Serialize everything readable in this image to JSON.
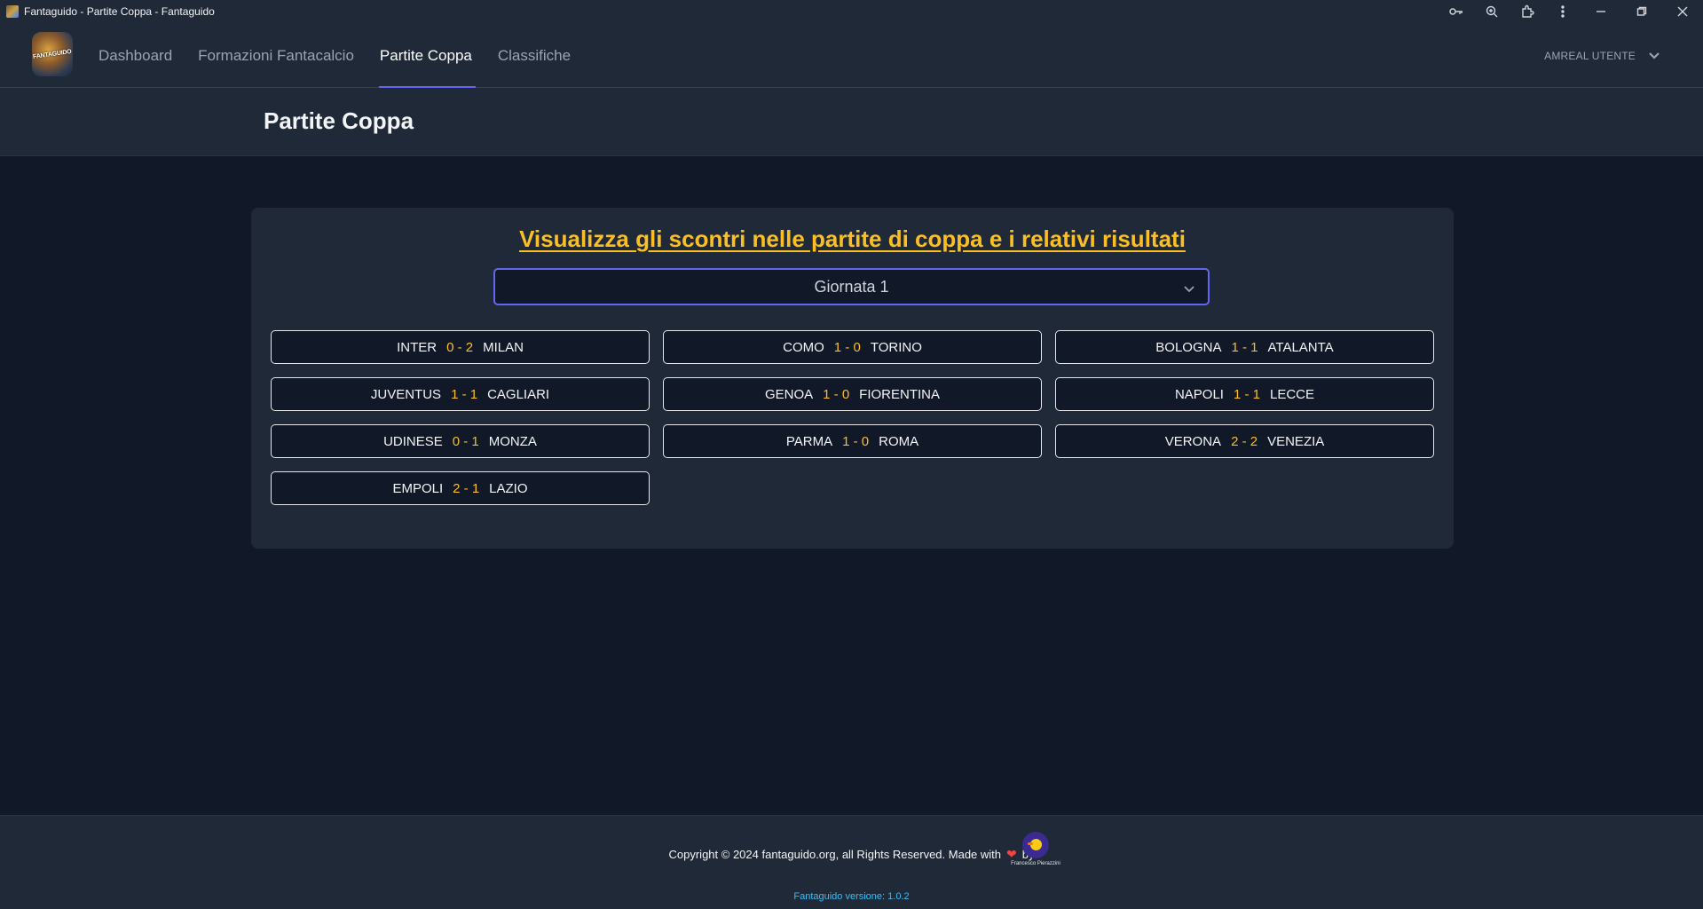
{
  "window": {
    "title": "Fantaguido - Partite Coppa - Fantaguido",
    "icons": [
      "key-icon",
      "zoom-icon",
      "extensions-icon",
      "more-icon",
      "minimize-icon",
      "restore-icon",
      "close-icon"
    ]
  },
  "nav": {
    "logo_text": "FANTAGUIDO",
    "links": [
      "Dashboard",
      "Formazioni Fantacalcio",
      "Partite Coppa",
      "Classifiche"
    ],
    "active": "Partite Coppa",
    "user_label": "AMREAL UTENTE"
  },
  "page": {
    "title": "Partite Coppa"
  },
  "card": {
    "heading": "Visualizza gli scontri nelle partite di coppa e i relativi risultati",
    "select_value": "Giornata 1",
    "matches": [
      {
        "home": "INTER",
        "score": "0 - 2",
        "away": "MILAN"
      },
      {
        "home": "COMO",
        "score": "1 - 0",
        "away": "TORINO"
      },
      {
        "home": "BOLOGNA",
        "score": "1 - 1",
        "away": "ATALANTA"
      },
      {
        "home": "JUVENTUS",
        "score": "1 - 1",
        "away": "CAGLIARI"
      },
      {
        "home": "GENOA",
        "score": "1 - 0",
        "away": "FIORENTINA"
      },
      {
        "home": "NAPOLI",
        "score": "1 - 1",
        "away": "LECCE"
      },
      {
        "home": "UDINESE",
        "score": "0 - 1",
        "away": "MONZA"
      },
      {
        "home": "PARMA",
        "score": "1 - 0",
        "away": "ROMA"
      },
      {
        "home": "VERONA",
        "score": "2 - 2",
        "away": "VENEZIA"
      },
      {
        "home": "EMPOLI",
        "score": "2 - 1",
        "away": "LAZIO"
      }
    ]
  },
  "footer": {
    "copyright": "Copyright © 2024 fantaguido.org, all Rights Reserved. Made with",
    "by": "by",
    "author_logo_text": "Francesco Pierazzini",
    "version": "Fantaguido versione: 1.0.2"
  },
  "colors": {
    "accent": "#6366f1",
    "score": "#fbbf24",
    "version": "#38bdf8"
  }
}
